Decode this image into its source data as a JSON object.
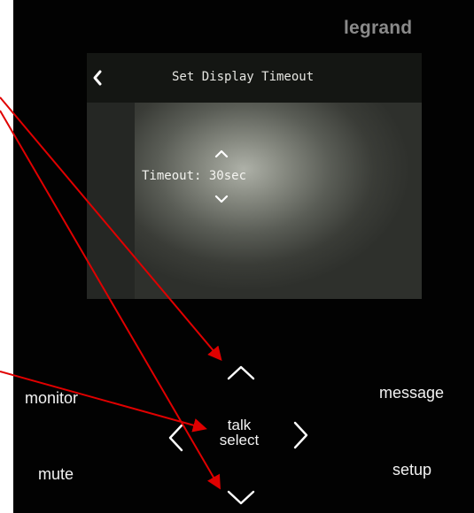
{
  "brand": {
    "logo_text": "legrand"
  },
  "screen": {
    "title": "Set Display Timeout",
    "back_icon": "chevron-left-icon",
    "timeout_label": "Timeout: 30sec",
    "increase_icon": "chevron-up-icon",
    "decrease_icon": "chevron-down-icon"
  },
  "keys": {
    "monitor": "monitor",
    "message": "message",
    "mute": "mute",
    "setup": "setup",
    "talk": "talk",
    "select": "select"
  },
  "nav_icons": {
    "up": "chevron-up-icon",
    "down": "chevron-down-icon",
    "left": "chevron-left-icon",
    "right": "chevron-right-icon"
  },
  "colors": {
    "panel": "#020202",
    "screen_header": "#141613",
    "brand_text": "#8a8a8a",
    "key_text": "#f2f2f2",
    "annotation_arrow": "#e00000"
  }
}
